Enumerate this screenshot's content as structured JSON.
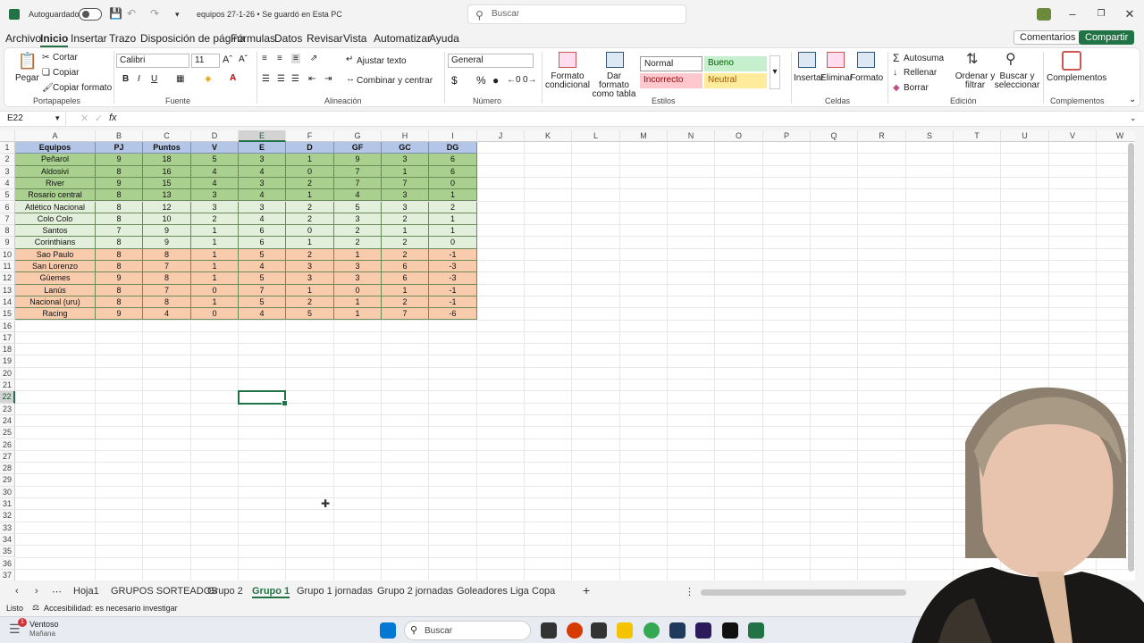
{
  "titlebar": {
    "autosave_label": "Autoguardado",
    "doc_title": "equipos 27-1-26 • Se guardó en Esta PC",
    "search_placeholder": "Buscar"
  },
  "menu": {
    "tabs": [
      "Archivo",
      "Inicio",
      "Insertar",
      "Trazo",
      "Disposición de página",
      "Fórmulas",
      "Datos",
      "Revisar",
      "Vista",
      "Automatizar",
      "Ayuda"
    ],
    "active": "Inicio",
    "comments_label": "Comentarios",
    "share_label": "Compartir"
  },
  "ribbon": {
    "clipboard": {
      "paste": "Pegar",
      "cut": "Cortar",
      "copy": "Copiar",
      "format_painter": "Copiar formato",
      "group": "Portapapeles"
    },
    "font": {
      "name": "Calibri",
      "size": "11",
      "group": "Fuente"
    },
    "alignment": {
      "wrap": "Ajustar texto",
      "merge": "Combinar y centrar",
      "group": "Alineación"
    },
    "number": {
      "format": "General",
      "group": "Número"
    },
    "styles": {
      "conditional": "Formato condicional",
      "as_table": "Dar formato como tabla",
      "normal": "Normal",
      "good": "Bueno",
      "bad": "Incorrecto",
      "neutral": "Neutral",
      "group": "Estilos"
    },
    "cells": {
      "insert": "Insertar",
      "delete": "Eliminar",
      "format": "Formato",
      "group": "Celdas"
    },
    "editing": {
      "autosum": "Autosuma",
      "fill": "Rellenar",
      "clear": "Borrar",
      "sort": "Ordenar y filtrar",
      "find": "Buscar y seleccionar",
      "group": "Edición"
    },
    "addins": {
      "label": "Complementos",
      "group": "Complementos"
    }
  },
  "formula_bar": {
    "name_box": "E22",
    "fx": "fx"
  },
  "columns": [
    "A",
    "B",
    "C",
    "D",
    "E",
    "F",
    "G",
    "H",
    "I",
    "J",
    "K",
    "L",
    "M",
    "N",
    "O",
    "P",
    "Q",
    "R",
    "S",
    "T",
    "U",
    "V",
    "W"
  ],
  "rows": [
    "1",
    "2",
    "3",
    "4",
    "5",
    "6",
    "7",
    "8",
    "9",
    "10",
    "11",
    "12",
    "13",
    "14",
    "15",
    "16",
    "17",
    "18",
    "19",
    "20",
    "21",
    "22",
    "23",
    "24",
    "25",
    "26",
    "27",
    "28",
    "29",
    "30",
    "31",
    "32",
    "33",
    "34",
    "35",
    "36",
    "37"
  ],
  "table": {
    "headers": [
      "Equipos",
      "PJ",
      "Puntos",
      "V",
      "E",
      "D",
      "GF",
      "GC",
      "DG"
    ],
    "rows": [
      [
        "Peñarol",
        "9",
        "18",
        "5",
        "3",
        "1",
        "9",
        "3",
        "6"
      ],
      [
        "Aldosivi",
        "8",
        "16",
        "4",
        "4",
        "0",
        "7",
        "1",
        "6"
      ],
      [
        "River",
        "9",
        "15",
        "4",
        "3",
        "2",
        "7",
        "7",
        "0"
      ],
      [
        "Rosario central",
        "8",
        "13",
        "3",
        "4",
        "1",
        "4",
        "3",
        "1"
      ],
      [
        "Atlético Nacional",
        "8",
        "12",
        "3",
        "3",
        "2",
        "5",
        "3",
        "2"
      ],
      [
        "Colo Colo",
        "8",
        "10",
        "2",
        "4",
        "2",
        "3",
        "2",
        "1"
      ],
      [
        "Santos",
        "7",
        "9",
        "1",
        "6",
        "0",
        "2",
        "1",
        "1"
      ],
      [
        "Corinthians",
        "8",
        "9",
        "1",
        "6",
        "1",
        "2",
        "2",
        "0"
      ],
      [
        "Sao Paulo",
        "8",
        "8",
        "1",
        "5",
        "2",
        "1",
        "2",
        "-1"
      ],
      [
        "San Lorenzo",
        "8",
        "7",
        "1",
        "4",
        "3",
        "3",
        "6",
        "-3"
      ],
      [
        "Güemes",
        "9",
        "8",
        "1",
        "5",
        "3",
        "3",
        "6",
        "-3"
      ],
      [
        "Lanús",
        "8",
        "7",
        "0",
        "7",
        "1",
        "0",
        "1",
        "-1"
      ],
      [
        "Nacional (uru)",
        "8",
        "8",
        "1",
        "5",
        "2",
        "1",
        "2",
        "-1"
      ],
      [
        "Racing",
        "9",
        "4",
        "0",
        "4",
        "5",
        "1",
        "7",
        "-6"
      ]
    ],
    "row_colors": [
      "#a9d08e",
      "#a9d08e",
      "#a9d08e",
      "#a9d08e",
      "#e2efda",
      "#e2efda",
      "#e2efda",
      "#e2efda",
      "#f8cbad",
      "#f8cbad",
      "#f8cbad",
      "#f8cbad",
      "#f8cbad",
      "#f8cbad"
    ]
  },
  "sheets": [
    "Hoja1",
    "GRUPOS SORTEADOS",
    "Grupo 2",
    "Grupo 1",
    "Grupo 1 jornadas",
    "Grupo 2 jornadas",
    "Goleadores Liga",
    "Copa"
  ],
  "active_sheet": "Grupo 1",
  "status": {
    "ready": "Listo",
    "accessibility": "Accesibilidad: es necesario investigar"
  },
  "taskbar": {
    "weather_title": "Ventoso",
    "weather_sub": "Mañana",
    "search": "Buscar"
  },
  "colors": {
    "accent": "#217346",
    "header_fill": "#b4c6e7"
  }
}
